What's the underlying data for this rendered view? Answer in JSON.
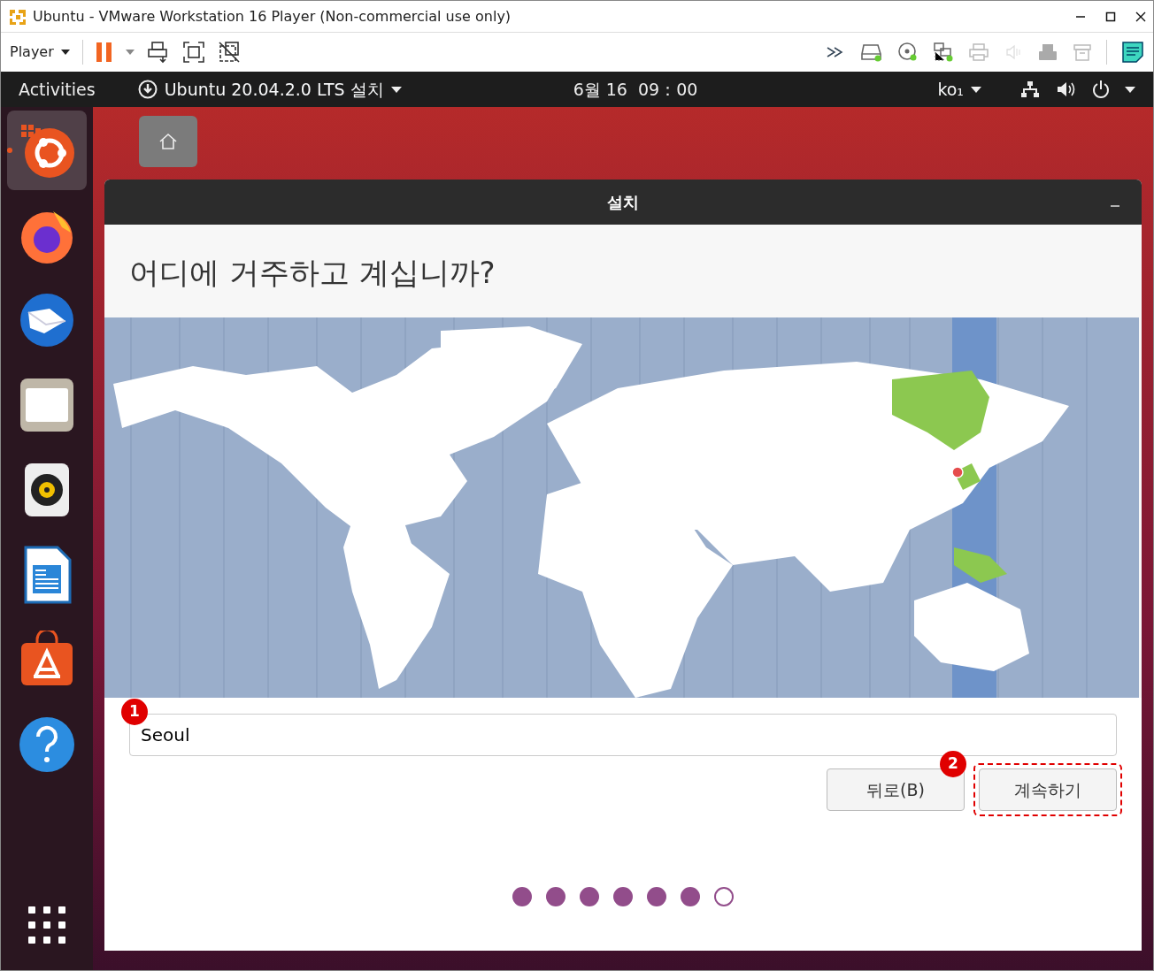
{
  "window": {
    "title": "Ubuntu - VMware Workstation 16 Player (Non-commercial use only)"
  },
  "toolbar": {
    "player_menu": "Player"
  },
  "top_bar": {
    "activities": "Activities",
    "app_menu": "Ubuntu 20.04.2.0 LTS 설치",
    "clock": "6월 16  09：00",
    "input_source": "ko₁"
  },
  "dock": [
    {
      "kind": "installer",
      "selected": true
    },
    {
      "kind": "browser",
      "selected": false
    },
    {
      "kind": "mail",
      "selected": false
    },
    {
      "kind": "files",
      "selected": false
    },
    {
      "kind": "music",
      "selected": false
    },
    {
      "kind": "document",
      "selected": false
    },
    {
      "kind": "store",
      "selected": false
    },
    {
      "kind": "help",
      "selected": false
    },
    {
      "kind": "apps",
      "selected": false
    }
  ],
  "installer": {
    "title": "설치",
    "heading": "어디에 거주하고 계십니까?",
    "timezone_field": {
      "value": "Seoul"
    },
    "buttons": [
      {
        "label": "뒤로(B)",
        "highlighted": false
      },
      {
        "label": "계속하기",
        "highlighted": true
      }
    ],
    "progress": [
      {
        "filled": true
      },
      {
        "filled": true
      },
      {
        "filled": true
      },
      {
        "filled": true
      },
      {
        "filled": true
      },
      {
        "filled": true
      },
      {
        "filled": false
      }
    ]
  },
  "annotations": [
    {
      "number": "1"
    },
    {
      "number": "2"
    }
  ]
}
